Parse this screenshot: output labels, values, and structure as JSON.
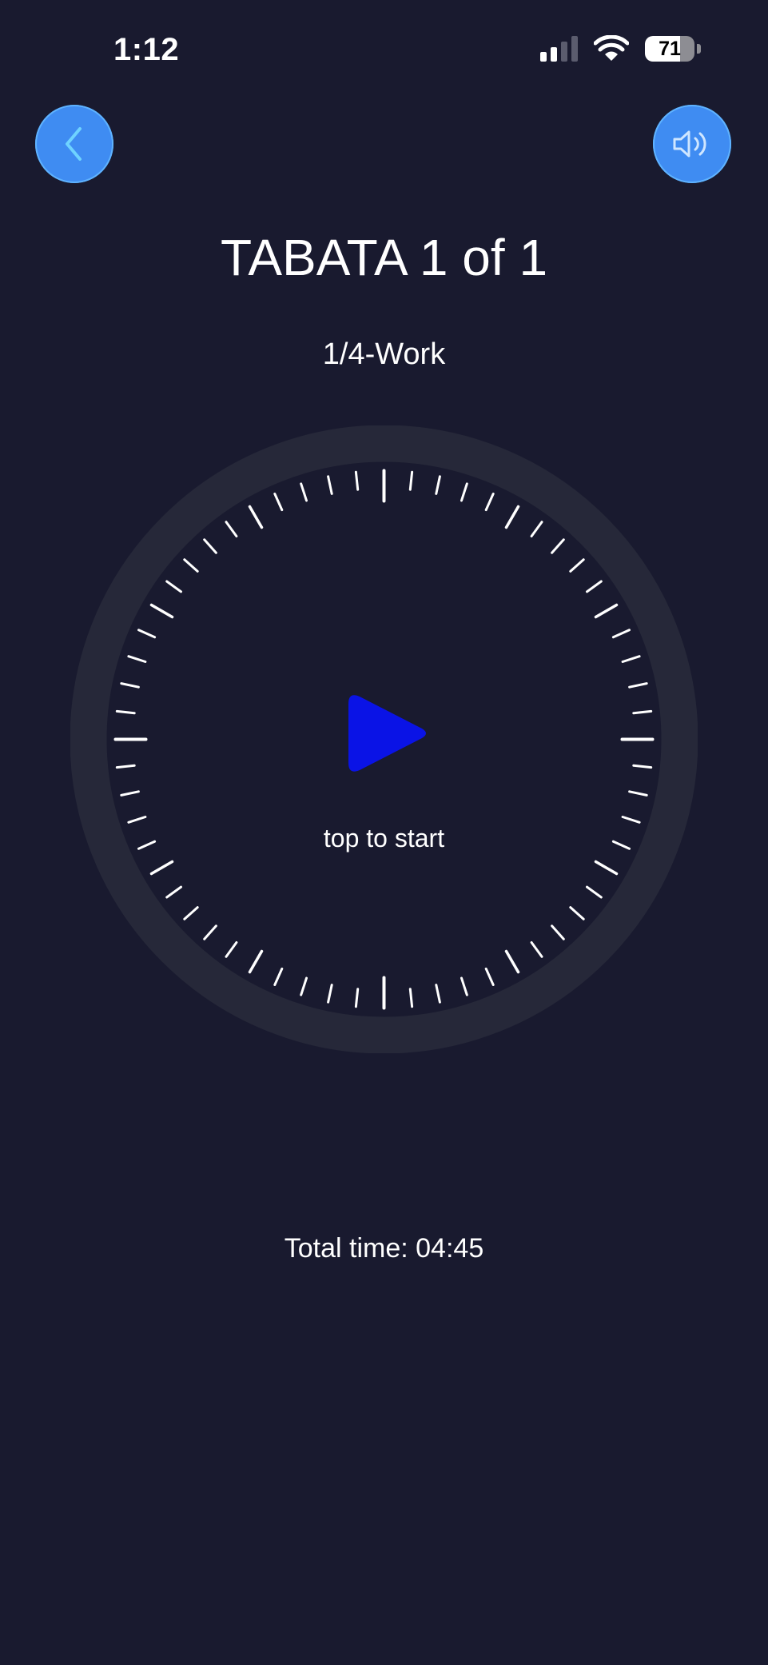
{
  "status_bar": {
    "time": "1:12",
    "battery_level": "71",
    "signal_bars_active": 2,
    "signal_bars_total": 4,
    "wifi_icon": "wifi-icon"
  },
  "header": {
    "back_icon": "chevron-left-icon",
    "sound_icon": "speaker-icon",
    "title": "TABATA 1 of 1",
    "phase": "1/4-Work"
  },
  "timer": {
    "play_icon": "play-icon",
    "hint": "top to start",
    "tick_count": 60
  },
  "footer": {
    "total_time": "Total time: 04:45"
  },
  "colors": {
    "background": "#191a2f",
    "button_blue": "#3f8cf2",
    "play_blue": "#0a13e6",
    "dial_ring": "#262839"
  }
}
